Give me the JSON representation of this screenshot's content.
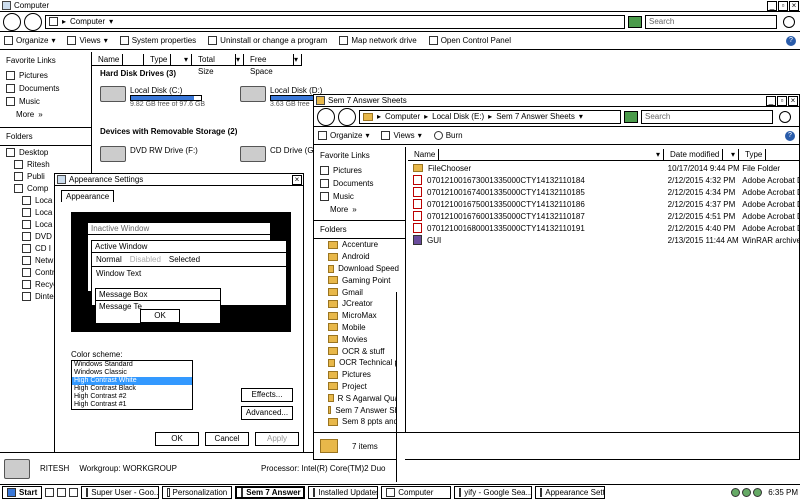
{
  "computer_window": {
    "title": "Computer",
    "address": "Computer",
    "search_placeholder": "Search",
    "toolbar": [
      "Organize",
      "Views",
      "System properties",
      "Uninstall or change a program",
      "Map network drive",
      "Open Control Panel"
    ],
    "favorite_links_title": "Favorite Links",
    "favorites": [
      "Pictures",
      "Documents",
      "Music"
    ],
    "more": "More",
    "folders_label": "Folders",
    "tree": [
      "Desktop",
      "Ritesh",
      "Publi",
      "Comp",
      "Loca",
      "Loca",
      "Loca",
      "DVD",
      "CD I",
      "Netw",
      "Contr",
      "Recyc",
      "Dinter"
    ],
    "columns": [
      "Name",
      "Type",
      "Total Size",
      "Free Space"
    ],
    "group_hdd": "Hard Disk Drives (3)",
    "drives": [
      {
        "name": "Local Disk (C:)",
        "free": "9.82 GB free of 97.6 GB",
        "fill": 0.9
      },
      {
        "name": "Local Disk (D:)",
        "free": "3.63 GB free",
        "fill": 0.85
      }
    ],
    "group_removable": "Devices with Removable Storage (2)",
    "removable": [
      "DVD RW Drive (F:)",
      "CD Drive (G:)"
    ],
    "details": {
      "name": "RITESH",
      "workgroup": "Workgroup: WORKGROUP",
      "processor": "Processor: Intel(R) Core(TM)2 Duo"
    }
  },
  "sem7_window": {
    "title": "Sem 7 Answer Sheets",
    "breadcrumb": [
      "Computer",
      "Local Disk (E:)",
      "Sem 7 Answer Sheets"
    ],
    "search_placeholder": "Search",
    "toolbar": [
      "Organize",
      "Views",
      "Burn"
    ],
    "favorite_links_title": "Favorite Links",
    "favorites": [
      "Pictures",
      "Documents",
      "Music"
    ],
    "more": "More",
    "folders_label": "Folders",
    "folders": [
      "Accenture",
      "Android",
      "Download Speed",
      "Gaming Point",
      "Gmail",
      "JCreator",
      "MicroMax",
      "Mobile",
      "Movies",
      "OCR & stuff",
      "OCR Technical p",
      "Pictures",
      "Project",
      "R S Agarwal Qua",
      "Sem 7 Answer Sh",
      "Sem 8 ppts and"
    ],
    "columns": [
      "Name",
      "Date modified",
      "Type"
    ],
    "files": [
      {
        "name": "FileChooser",
        "date": "10/17/2014 9:44 PM",
        "type": "File Folder",
        "icon": "folder"
      },
      {
        "name": "070121001673001335000CTY14132110184",
        "date": "2/12/2015 4:32 PM",
        "type": "Adobe Acrobat Do",
        "icon": "pdf"
      },
      {
        "name": "070121001674001335000CTY14132110185",
        "date": "2/12/2015 4:34 PM",
        "type": "Adobe Acrobat Do",
        "icon": "pdf"
      },
      {
        "name": "070121001675001335000CTY14132110186",
        "date": "2/12/2015 4:37 PM",
        "type": "Adobe Acrobat Do",
        "icon": "pdf"
      },
      {
        "name": "070121001676001335000CTY14132110187",
        "date": "2/12/2015 4:51 PM",
        "type": "Adobe Acrobat Do",
        "icon": "pdf"
      },
      {
        "name": "070121001680001335000CTY14132110191",
        "date": "2/12/2015 4:40 PM",
        "type": "Adobe Acrobat Do",
        "icon": "pdf"
      },
      {
        "name": "GUI",
        "date": "2/13/2015 11:44 AM",
        "type": "WinRAR archive",
        "icon": "rar"
      }
    ],
    "status": "7 items"
  },
  "appearance": {
    "title": "Appearance Settings",
    "tab": "Appearance",
    "inactive_window": "Inactive Window",
    "active_window": "Active Window",
    "menu": [
      "Normal",
      "Disabled",
      "Selected"
    ],
    "window_text": "Window Text",
    "message_box": "Message Box",
    "message_text": "Message Te",
    "ok_preview": "OK",
    "scheme_label": "Color scheme:",
    "schemes": [
      "Windows Standard",
      "Windows Classic",
      "High Contrast White",
      "High Contrast Black",
      "High Contrast #2",
      "High Contrast #1"
    ],
    "selected_scheme": 2,
    "effects": "Effects...",
    "advanced": "Advanced...",
    "ok": "OK",
    "cancel": "Cancel",
    "apply": "Apply"
  },
  "taskbar": {
    "start": "Start",
    "items": [
      "Super User - Goo...",
      "Personalization",
      "Sem 7 Answer S...",
      "Installed Updates",
      "Computer",
      "yify - Google Sea...",
      "Appearance Setti..."
    ],
    "active": 2,
    "time": "6:35 PM"
  }
}
